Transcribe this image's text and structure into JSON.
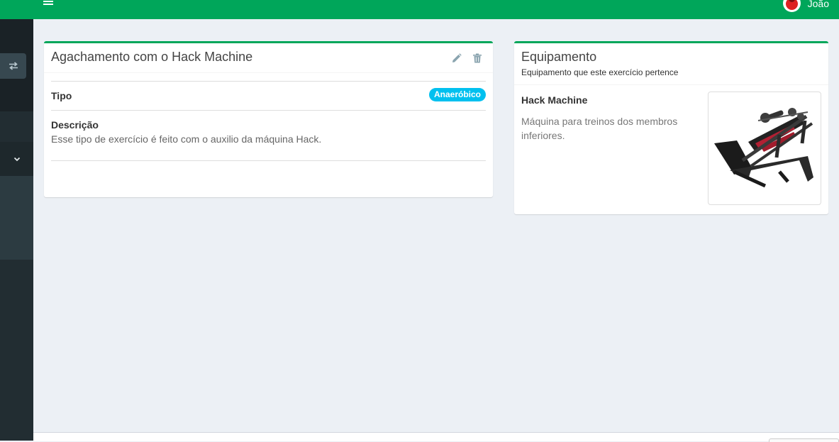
{
  "user": {
    "name": "João"
  },
  "exercise": {
    "title": "Agachamento com o Hack Machine",
    "type_label": "Tipo",
    "type_badge": "Anaeróbico",
    "description_label": "Descrição",
    "description": "Esse tipo de exercício é feito com o auxilio da máquina Hack."
  },
  "equipment": {
    "title": "Equipamento",
    "subtitle": "Equipamento que este exercício pertence",
    "name": "Hack Machine",
    "description": "Máquina para treinos dos membros inferiores."
  },
  "colors": {
    "primary": "#00a65a",
    "badge": "#00c0ef",
    "sidebar": "#222d32",
    "background": "#ecf0f5"
  },
  "icons": {
    "menu": "hamburger-icon",
    "switch": "exchange-icon",
    "chevron": "chevron-down-icon",
    "edit": "pencil-icon",
    "delete": "trash-icon"
  }
}
